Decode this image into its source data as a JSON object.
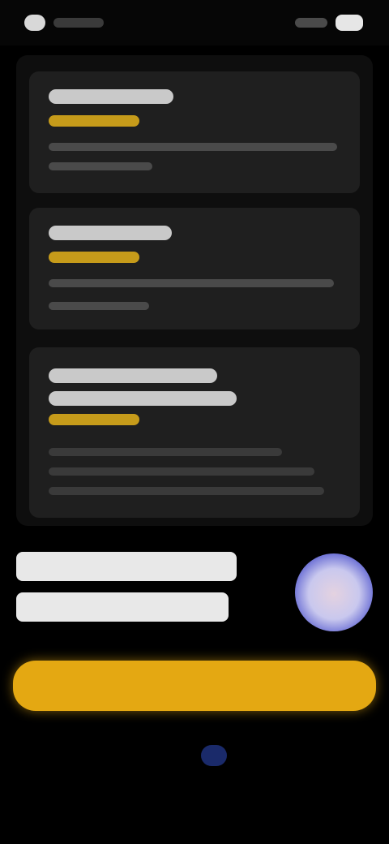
{
  "status_bar": {
    "time": "",
    "battery": ""
  },
  "reviews": [
    {
      "title": "",
      "rating": "",
      "body": ""
    },
    {
      "title": "",
      "rating": "",
      "body": ""
    },
    {
      "title": "",
      "rating": "",
      "body": ""
    }
  ],
  "promo": {
    "heading_line1": "",
    "heading_line2": ""
  },
  "cta": {
    "label": ""
  },
  "colors": {
    "background": "#000000",
    "card": "#1f1f1f",
    "accent": "#e4a812",
    "rating": "#c69b1a",
    "badge": "#5a5fd0"
  },
  "icons": {
    "promo_badge": "avatar-badge-icon"
  }
}
